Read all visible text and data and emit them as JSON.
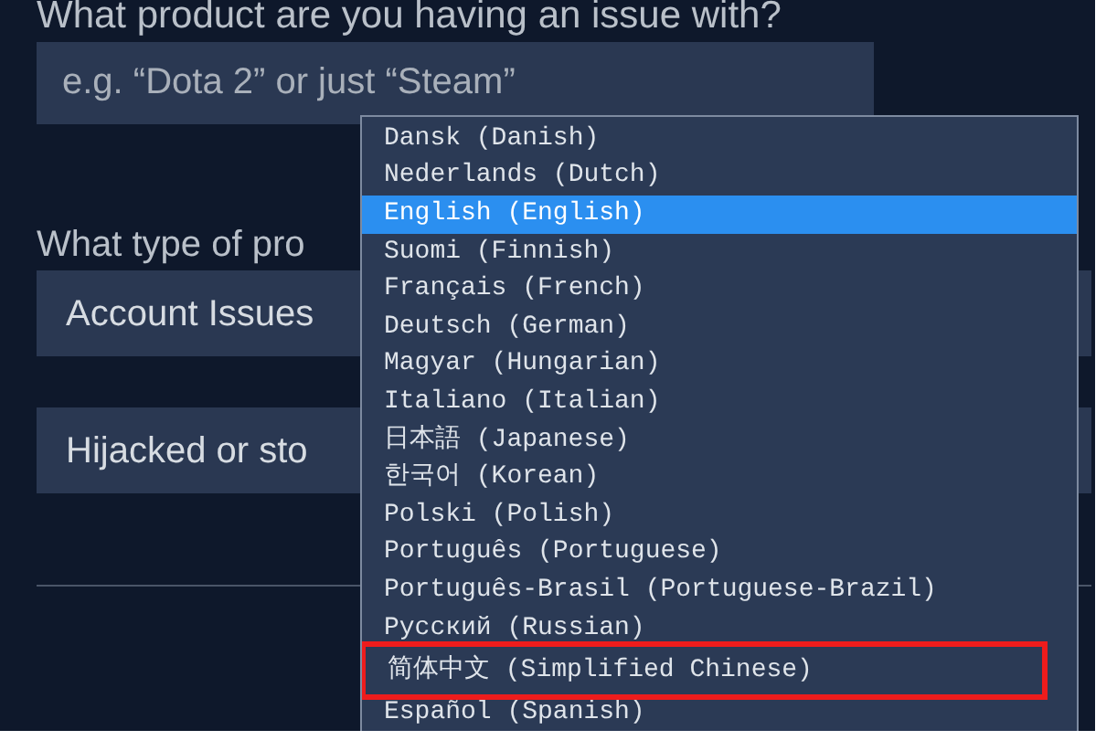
{
  "product_question": {
    "label": "What product are you having an issue with?",
    "placeholder": "e.g. “Dota 2” or just “Steam”"
  },
  "type_question": {
    "label": "What type of pro"
  },
  "selects": [
    {
      "value": "Account Issues"
    },
    {
      "value": "Hijacked or sto"
    }
  ],
  "language_dropdown": {
    "options": [
      {
        "label": "Dansk (Danish)",
        "selected": false,
        "annotated": false
      },
      {
        "label": "Nederlands (Dutch)",
        "selected": false,
        "annotated": false
      },
      {
        "label": "English (English)",
        "selected": true,
        "annotated": false
      },
      {
        "label": "Suomi (Finnish)",
        "selected": false,
        "annotated": false
      },
      {
        "label": "Français (French)",
        "selected": false,
        "annotated": false
      },
      {
        "label": "Deutsch (German)",
        "selected": false,
        "annotated": false
      },
      {
        "label": "Magyar (Hungarian)",
        "selected": false,
        "annotated": false
      },
      {
        "label": "Italiano (Italian)",
        "selected": false,
        "annotated": false
      },
      {
        "label": "日本語 (Japanese)",
        "selected": false,
        "annotated": false
      },
      {
        "label": "한국어 (Korean)",
        "selected": false,
        "annotated": false
      },
      {
        "label": "Polski (Polish)",
        "selected": false,
        "annotated": false
      },
      {
        "label": "Português (Portuguese)",
        "selected": false,
        "annotated": false
      },
      {
        "label": "Português-Brasil (Portuguese-Brazil)",
        "selected": false,
        "annotated": false
      },
      {
        "label": "Русский (Russian)",
        "selected": false,
        "annotated": false
      },
      {
        "label": "简体中文 (Simplified Chinese)",
        "selected": false,
        "annotated": true
      },
      {
        "label": "Español (Spanish)",
        "selected": false,
        "annotated": false
      }
    ]
  }
}
